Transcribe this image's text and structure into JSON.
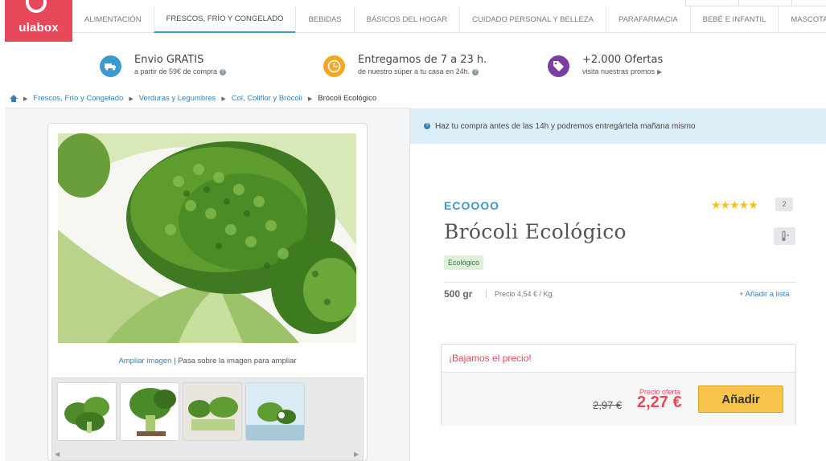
{
  "brand_logo": "ulabox",
  "nav": {
    "tabs": [
      {
        "label": "ALIMENTACIÓN",
        "active": false
      },
      {
        "label": "FRESCOS, FRÍO Y CONGELADO",
        "active": true
      },
      {
        "label": "BEBIDAS",
        "active": false
      },
      {
        "label": "BÁSICOS DEL HOGAR",
        "active": false
      },
      {
        "label": "CUIDADO PERSONAL Y BELLEZA",
        "active": false
      },
      {
        "label": "PARAFARMACIA",
        "active": false
      },
      {
        "label": "BEBÉ E INFANTIL",
        "active": false
      },
      {
        "label": "MASCOTAS",
        "active": false
      }
    ]
  },
  "benefits": [
    {
      "title": "Envio GRATIS",
      "subtitle": "a partir de 59€ de compra",
      "icon": "truck-icon",
      "color": "#3b9bd1"
    },
    {
      "title": "Entregamos de 7 a 23 h.",
      "subtitle": "de nuestro súper a tu casa en 24h.",
      "icon": "clock-icon",
      "color": "#f5a623"
    },
    {
      "title": "+2.000 Ofertas",
      "subtitle": "visita nuestras promos",
      "icon": "tag-icon",
      "color": "#7b3fa3"
    }
  ],
  "breadcrumb": {
    "items": [
      "Frescos, Frío y Congelado",
      "Verduras y Legumbres",
      "Col, Coliflor y Brócoli"
    ],
    "current": "Brócoli Ecológico"
  },
  "gallery": {
    "zoom_link": "Ampliar imagen",
    "zoom_hint": " | Pasa sobre la imagen para ampliar"
  },
  "notice": "Haz tu compra antes de las 14h y podremos entregártela mañana mismo",
  "product": {
    "brand": "ECOOOO",
    "title": "Brócoli Ecológico",
    "stars": "★★★★★",
    "rating_count": "2",
    "tag": "Ecológico",
    "weight": "500 gr",
    "unit_price": "Precio 4,54 € / Kg.",
    "add_to_list": "+ Añadir a lista"
  },
  "pricing": {
    "header": "¡Bajamos el precio!",
    "old_price": "2,97 €",
    "offer_label": "Precio oferta",
    "offer_price": "2,27 €",
    "add_button": "Añadir"
  },
  "colors": {
    "brand": "#e8495a",
    "accent": "#3b9bd1",
    "button": "#f7c34d"
  }
}
